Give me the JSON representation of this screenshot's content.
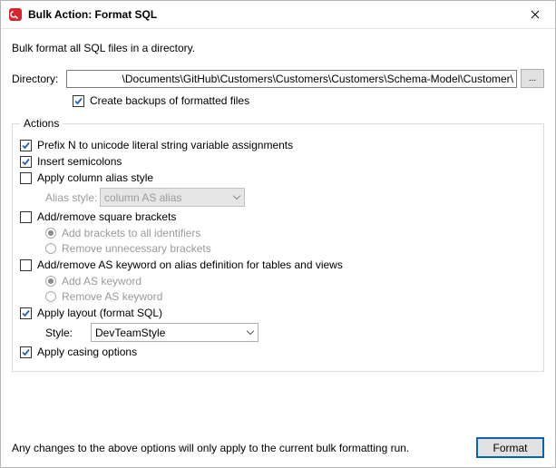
{
  "title": "Bulk Action: Format SQL",
  "intro": "Bulk format all SQL files in a directory.",
  "directory": {
    "label": "Directory:",
    "value": "\\Documents\\GitHub\\Customers\\Customers\\Customers\\Schema-Model\\Customer\\",
    "browse": "..."
  },
  "backup": {
    "label": "Create backups of formatted files",
    "checked": true
  },
  "actions": {
    "legend": "Actions",
    "prefixN": {
      "label": "Prefix N to unicode literal string variable assignments",
      "checked": true
    },
    "semicolons": {
      "label": "Insert semicolons",
      "checked": true
    },
    "aliasStyle": {
      "label": "Apply column alias style",
      "checked": false,
      "fieldLabel": "Alias style:",
      "value": "column AS alias"
    },
    "brackets": {
      "label": "Add/remove square brackets",
      "checked": false,
      "opts": {
        "add": {
          "label": "Add brackets to all identifiers",
          "selected": true
        },
        "remove": {
          "label": "Remove unnecessary brackets",
          "selected": false
        }
      }
    },
    "asKeyword": {
      "label": "Add/remove AS keyword on alias definition for tables and views",
      "checked": false,
      "opts": {
        "add": {
          "label": "Add AS keyword",
          "selected": true
        },
        "remove": {
          "label": "Remove AS keyword",
          "selected": false
        }
      }
    },
    "layout": {
      "label": "Apply layout (format SQL)",
      "checked": true,
      "styleLabel": "Style:",
      "styleValue": "DevTeamStyle"
    },
    "casing": {
      "label": "Apply casing options",
      "checked": true
    }
  },
  "footerNote": "Any changes to the above options will only apply to the current bulk formatting run.",
  "formatButton": "Format"
}
